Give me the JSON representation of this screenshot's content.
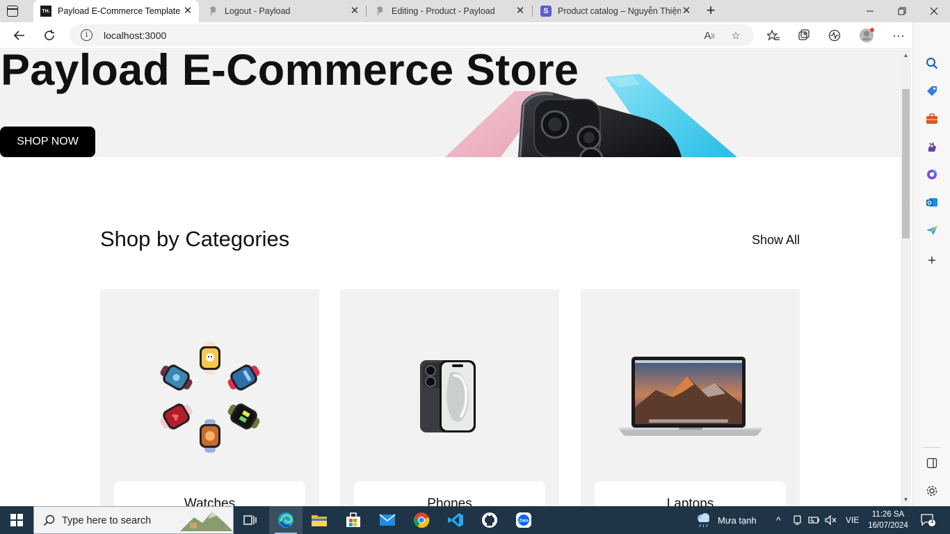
{
  "browser": {
    "tabs": [
      {
        "title": "Payload E-Commerce Template",
        "favicon": "TH.",
        "active": true
      },
      {
        "title": "Logout - Payload",
        "favicon": "payload-icon",
        "active": false
      },
      {
        "title": "Editing - Product - Payload",
        "favicon": "payload-icon",
        "active": false
      },
      {
        "title": "Product catalog – Nguyễn Thiện",
        "favicon": "S",
        "active": false
      }
    ],
    "url": "localhost:3000"
  },
  "page": {
    "hero": {
      "title": "Payload E-Commerce Store",
      "button_label": "SHOP NOW"
    },
    "categories": {
      "title": "Shop by Categories",
      "show_all_label": "Show All",
      "items": [
        {
          "label": "Watches",
          "image": "watch-collection-image"
        },
        {
          "label": "Phones",
          "image": "phone-image"
        },
        {
          "label": "Laptops",
          "image": "laptop-image"
        }
      ]
    }
  },
  "taskbar": {
    "search_placeholder": "Type here to search",
    "weather": "Mưa tạnh",
    "language": "VIE",
    "time": "11:26 SA",
    "date": "16/07/2024",
    "notification_count": "1"
  },
  "colors": {
    "hero_bg": "#f2f2f2",
    "button_bg": "#000000",
    "card_bg": "#f2f2f2",
    "taskbar_bg": "#1f3447"
  }
}
